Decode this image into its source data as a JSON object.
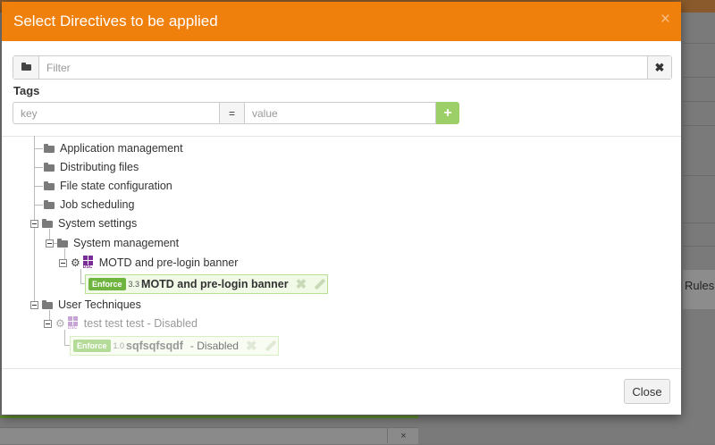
{
  "modal": {
    "title": "Select Directives to be applied",
    "close_icon": "×",
    "close_button": "Close"
  },
  "filter": {
    "placeholder": "Filter",
    "folder_icon": "folder-open-icon",
    "clear_icon": "✖"
  },
  "tags": {
    "label": "Tags",
    "key_placeholder": "key",
    "equals": "=",
    "value_placeholder": "value",
    "add_icon": "+"
  },
  "tree": {
    "categories": [
      {
        "label": "Application management"
      },
      {
        "label": "Distributing files"
      },
      {
        "label": "File state configuration"
      },
      {
        "label": "Job scheduling"
      },
      {
        "label": "System settings"
      },
      {
        "label": "System management"
      },
      {
        "label": "User Techniques"
      }
    ],
    "techniques": [
      {
        "label": "MOTD and pre-login banner",
        "os_badge": "DSC"
      },
      {
        "label": "test test test",
        "status": " - Disabled",
        "os_badge": "DSC"
      }
    ],
    "directives": [
      {
        "badge": "Enforce",
        "version": "3.3",
        "name": "MOTD and pre-login banner",
        "status": ""
      },
      {
        "badge": "Enforce",
        "version": "1.0",
        "name": "sqfsqfsqdf",
        "status": "- Disabled"
      }
    ]
  },
  "background": {
    "rules_text": "Rules u",
    "bottom_btn": "×"
  },
  "colors": {
    "header": "#f0800c",
    "enforce_badge": "#6fb43f",
    "add_button": "#9ccf68",
    "windows_icon": "#7a2c98"
  }
}
